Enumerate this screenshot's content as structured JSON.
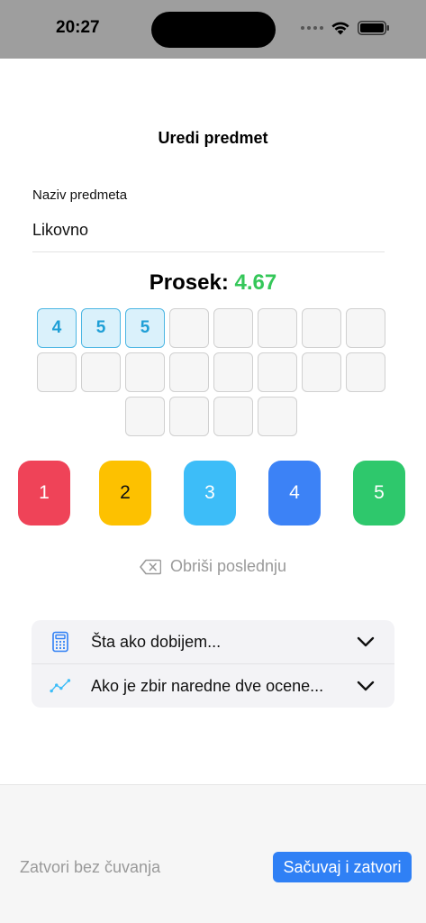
{
  "status_bar": {
    "time": "20:27"
  },
  "sheet": {
    "title": "Uredi predmet"
  },
  "subject_field": {
    "label": "Naziv predmeta",
    "value": "Likovno"
  },
  "average": {
    "label": "Prosek:",
    "value": "4.67",
    "value_color": "#34c759"
  },
  "grades": {
    "cells": [
      "4",
      "5",
      "5",
      "",
      "",
      "",
      "",
      "",
      "",
      "",
      "",
      "",
      "",
      "",
      "",
      "",
      "",
      "",
      "",
      ""
    ]
  },
  "grade_buttons": [
    {
      "label": "1",
      "color": "#ef4358",
      "text_color": "#ffffff"
    },
    {
      "label": "2",
      "color": "#fdc100",
      "text_color": "#111111"
    },
    {
      "label": "3",
      "color": "#3dbdf8",
      "text_color": "#ffffff"
    },
    {
      "label": "4",
      "color": "#3c82f6",
      "text_color": "#ffffff"
    },
    {
      "label": "5",
      "color": "#2ec86c",
      "text_color": "#ffffff"
    }
  ],
  "delete_last": {
    "label": "Obriši poslednju",
    "icon": "delete-backspace-icon"
  },
  "accordion": {
    "items": [
      {
        "label": "Šta ako dobijem...",
        "icon": "calculator-icon"
      },
      {
        "label": "Ako je zbir naredne dve ocene...",
        "icon": "trend-chart-icon"
      }
    ]
  },
  "footer": {
    "close_without_saving": "Zatvori bez čuvanja",
    "save_and_close": "Sačuvaj i zatvori"
  }
}
